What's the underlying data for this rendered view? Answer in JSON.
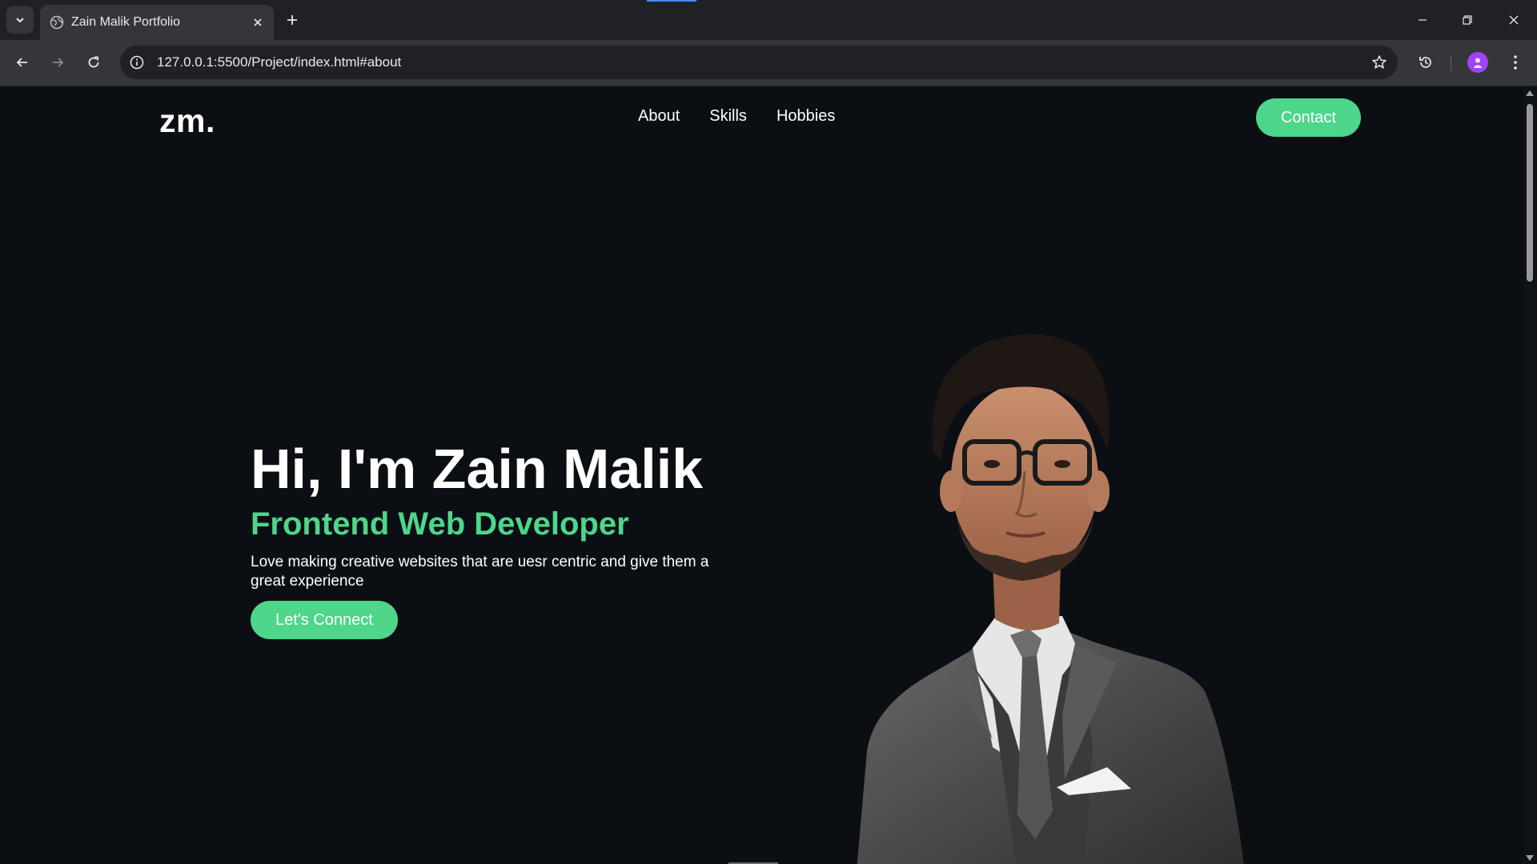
{
  "browser": {
    "tab_title": "Zain Malik Portfolio",
    "url": "127.0.0.1:5500/Project/index.html#about"
  },
  "site": {
    "logo": "zm.",
    "nav": [
      "About",
      "Skills",
      "Hobbies"
    ],
    "contact_label": "Contact"
  },
  "hero": {
    "title": "Hi, I'm Zain Malik",
    "role": "Frontend Web Developer",
    "description": "Love making creative websites that are uesr centric and give them a great experience",
    "cta_label": "Let's Connect"
  },
  "colors": {
    "accent": "#4ed68a",
    "page_bg": "#0b0f14",
    "chrome_bg": "#202124",
    "toolbar_bg": "#35363a"
  },
  "icons": {
    "tab_search": "chevron-down-icon",
    "favicon": "globe-icon",
    "tab_close": "close-icon",
    "new_tab": "plus-icon",
    "back": "arrow-left-icon",
    "forward": "arrow-right-icon",
    "reload": "reload-icon",
    "site_info": "info-icon",
    "bookmark": "star-icon",
    "history": "history-icon",
    "profile": "avatar-icon",
    "menu": "kebab-menu-icon"
  }
}
